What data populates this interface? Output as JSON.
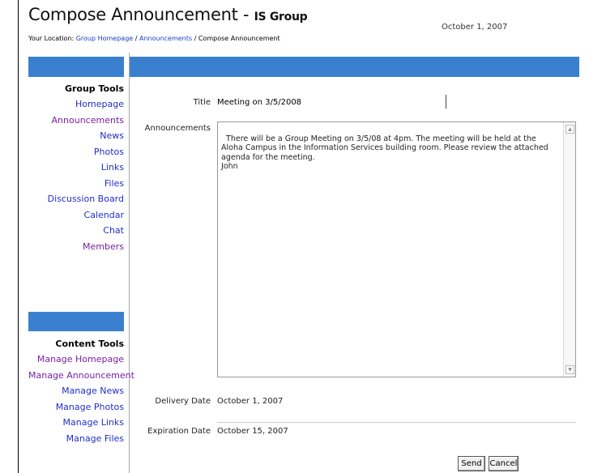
{
  "header": {
    "title": "Compose Announcement - ",
    "group": "IS Group",
    "date": "October 1, 2007",
    "breadcrumb_prefix": "Your Location: ",
    "breadcrumb_home": "Group Homepage",
    "breadcrumb_sep1": " / ",
    "breadcrumb_announcements": "Announcements",
    "breadcrumb_sep2": " / ",
    "breadcrumb_current": "Compose Announcement"
  },
  "group_tools": {
    "heading": "Group Tools",
    "items": [
      "Homepage",
      "Announcements",
      "News",
      "Photos",
      "Links",
      "Files",
      "Discussion Board",
      "Calendar",
      "Chat",
      "Members"
    ]
  },
  "content_tools": {
    "heading": "Content Tools",
    "items": [
      "Manage Homepage",
      "Manage Announcement",
      "Manage News",
      "Manage Photos",
      "Manage Links",
      "Manage Files"
    ]
  },
  "form": {
    "title_label": "Title",
    "title_value": "Meeting on 3/5/2008",
    "announcement_label": "Announcements",
    "announcement_value": "There will be a Group Meeting on 3/5/08 at 4pm. The meeting will be held at the Aloha Campus in the Information Services building room. Please review the attached agenda for the meeting.\nJohn",
    "delivery_label": "Delivery Date",
    "delivery_value": "October 1, 2007",
    "expiration_label": "Expiration Date",
    "expiration_value": "October 15, 2007"
  },
  "buttons": {
    "send": "Send",
    "cancel": "Cancel"
  },
  "colors": {
    "bar_blue": "#3b80ce",
    "link_blue": "#1f2fc8",
    "visited_purple": "#7a1fa8"
  }
}
